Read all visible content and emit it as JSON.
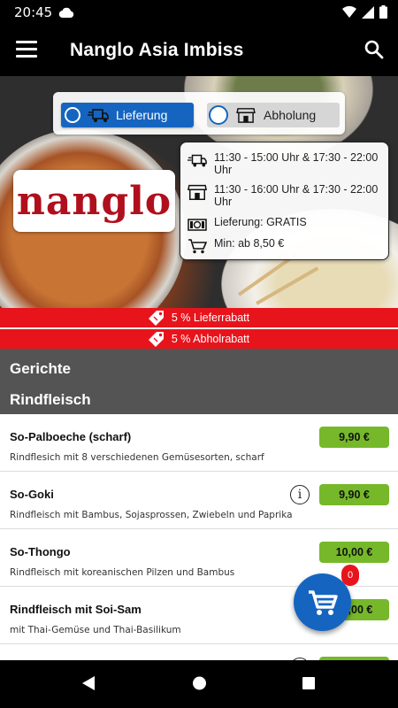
{
  "status_bar": {
    "time": "20:45"
  },
  "app_bar": {
    "title": "Nanglo Asia Imbiss"
  },
  "delivery_toggle": {
    "options": [
      {
        "label": "Lieferung",
        "selected": true
      },
      {
        "label": "Abholung",
        "selected": false
      }
    ]
  },
  "logo": {
    "text": "nanglo"
  },
  "info": {
    "delivery_hours": "11:30 - 15:00 Uhr & 17:30 - 22:00 Uhr",
    "pickup_hours": "11:30 - 16:00 Uhr & 17:30 - 22:00 Uhr",
    "delivery_fee": "Lieferung: GRATIS",
    "minimum_order": "Min: ab 8,50 €"
  },
  "discounts": [
    {
      "text": "5 % Lieferrabatt"
    },
    {
      "text": "5 % Abholrabatt"
    }
  ],
  "menu": {
    "section_title": "Gerichte",
    "category_title": "Rindfleisch",
    "items": [
      {
        "name": "So-Palboeche (scharf)",
        "description": "Rindflesich mit 8 verschiedenen Gemüsesorten, scharf",
        "price": "9,90 €",
        "has_info": false
      },
      {
        "name": "So-Goki",
        "description": "Rindfleisch mit Bambus, Sojasprossen, Zwiebeln und Paprika",
        "price": "9,90 €",
        "has_info": true
      },
      {
        "name": "So-Thongo",
        "description": "Rindfleisch mit koreanischen Pilzen und Bambus",
        "price": "10,00 €",
        "has_info": false
      },
      {
        "name": "Rindfleisch mit Soi-Sam",
        "description": "mit Thai-Gemüse und Thai-Basilikum",
        "price": "10,00 €",
        "has_info": false
      }
    ]
  },
  "cart": {
    "count": "0"
  },
  "colors": {
    "primary": "#1565c0",
    "price_green": "#76b82a",
    "discount_red": "#e8141c",
    "logo_red": "#b00f1d",
    "category_gray": "#545454"
  },
  "icons": [
    "menu-icon",
    "search-icon",
    "delivery-truck-icon",
    "store-icon",
    "money-icon",
    "cart-icon",
    "tag-icon",
    "info-icon",
    "back-icon",
    "home-icon",
    "recents-icon"
  ]
}
